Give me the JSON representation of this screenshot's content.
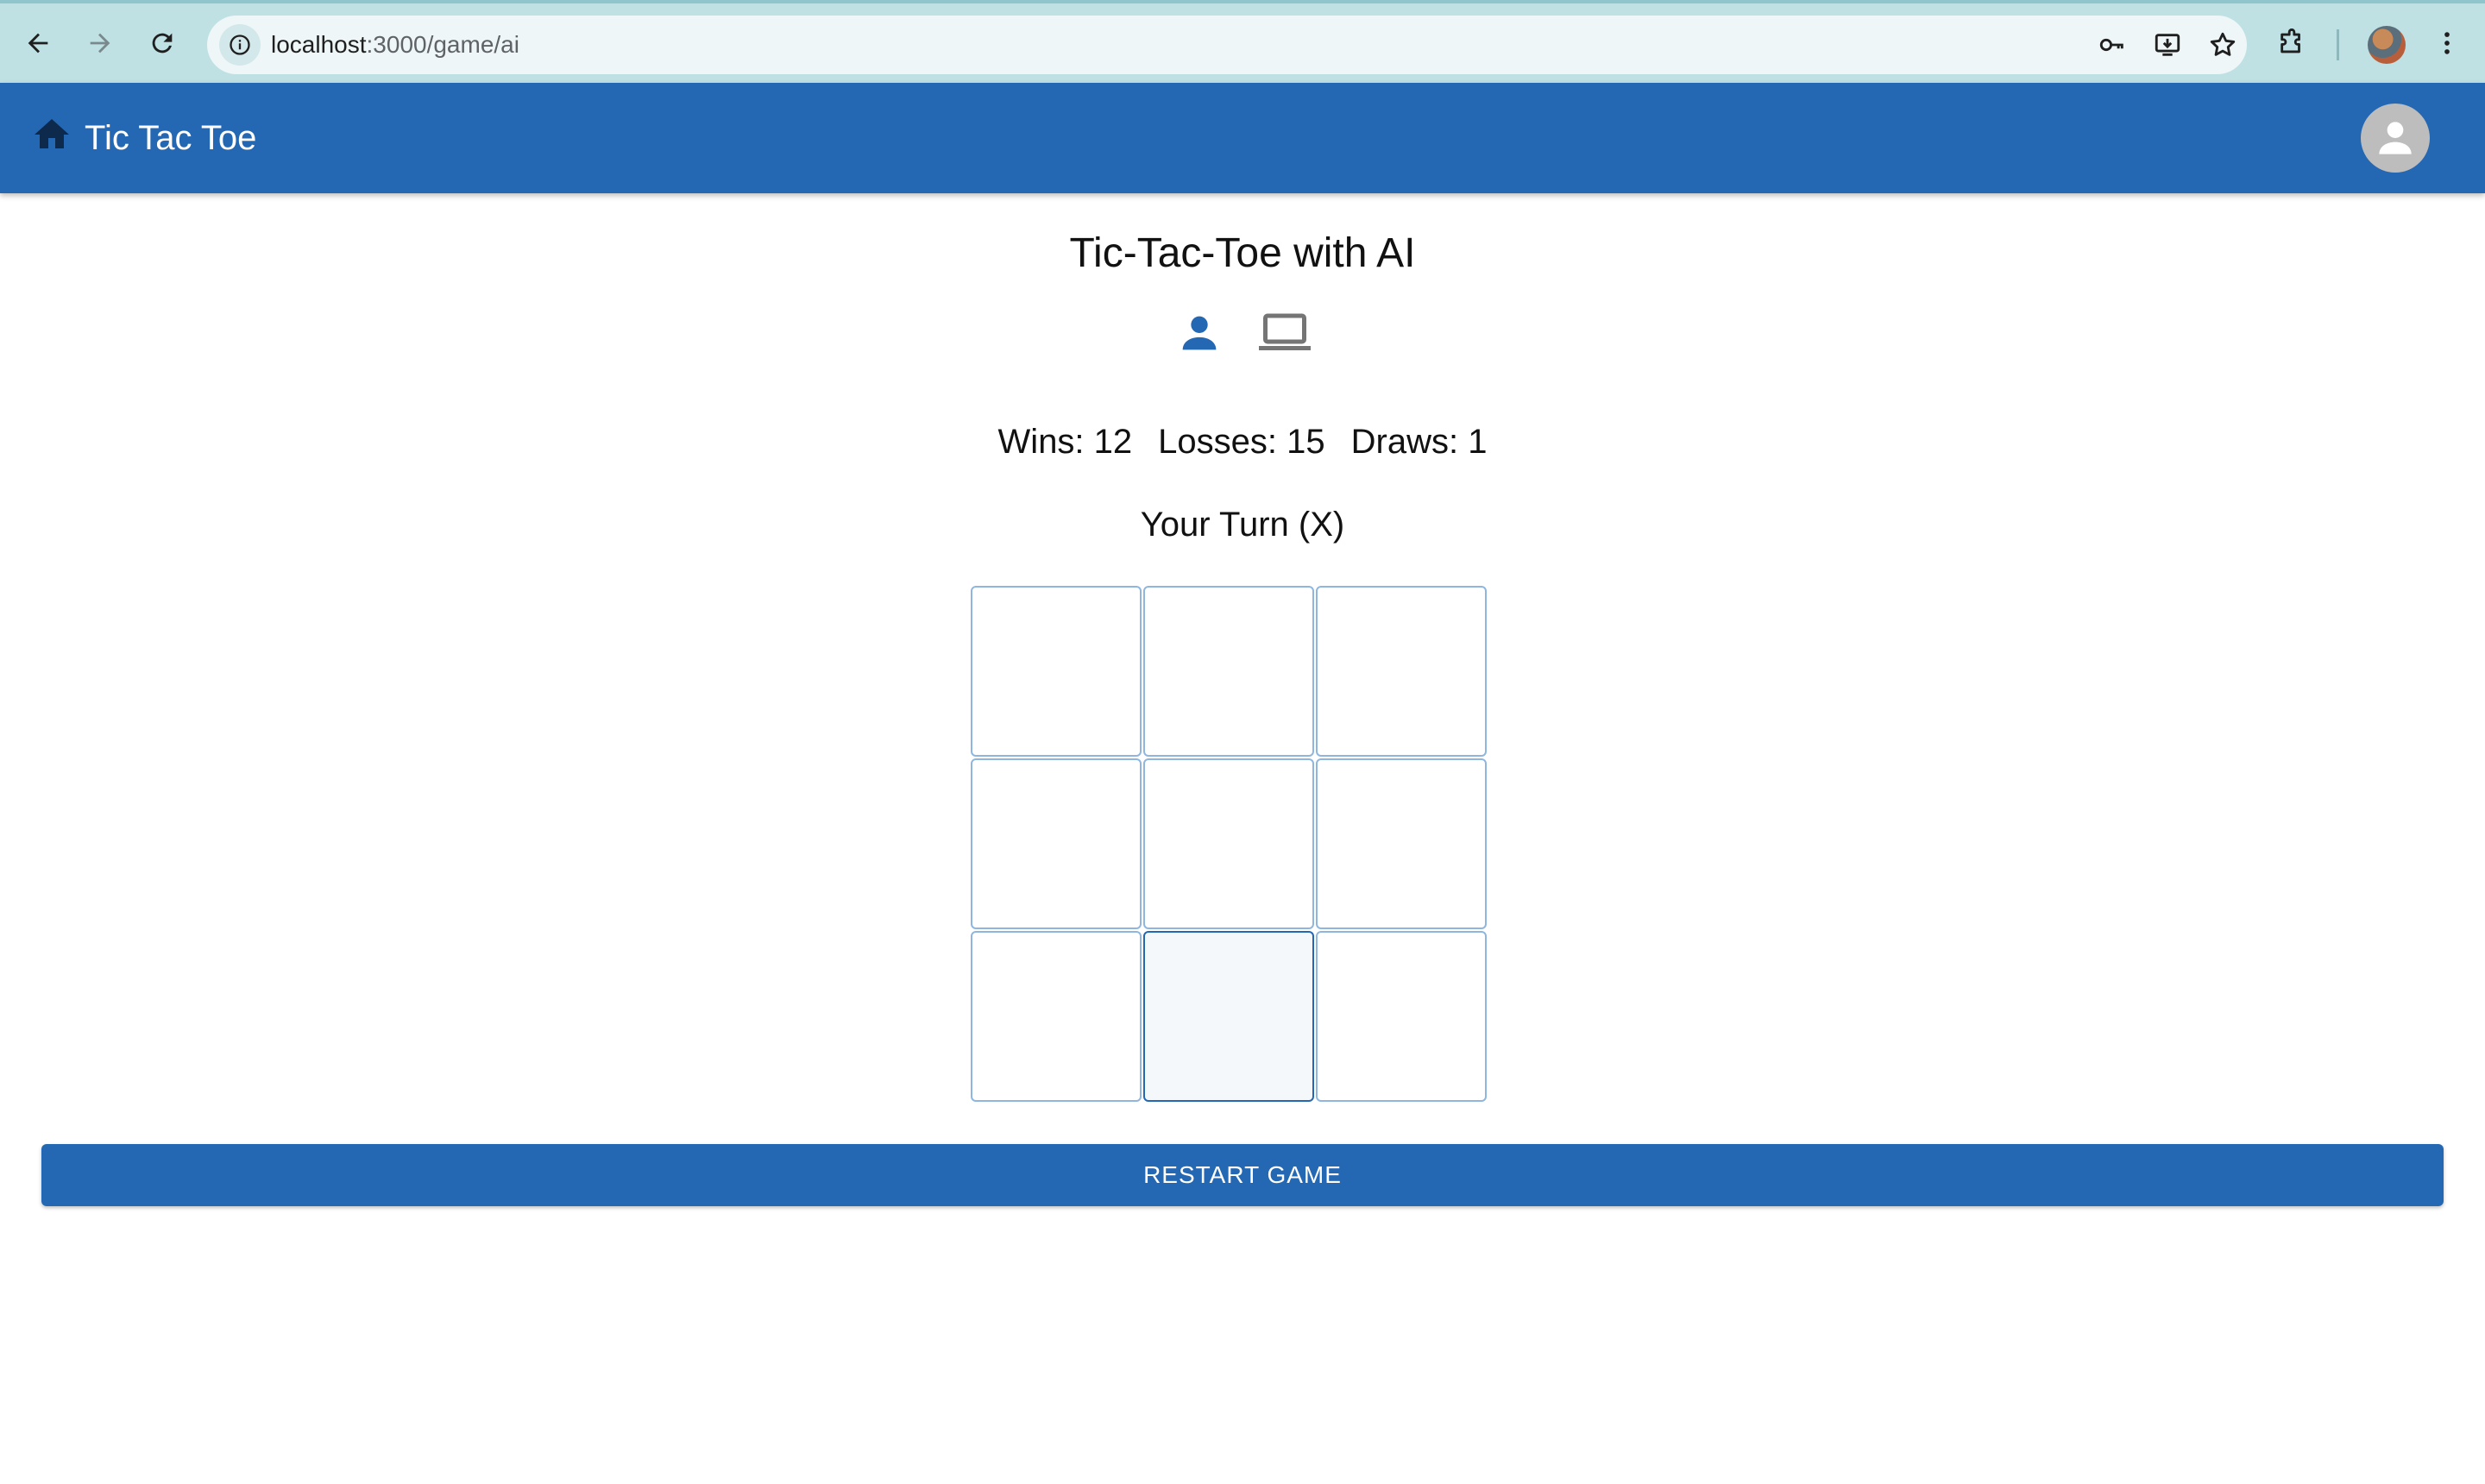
{
  "browser": {
    "url_host": "localhost",
    "url_path": ":3000/game/ai"
  },
  "app_bar": {
    "title": "Tic Tac Toe",
    "color": "#2467b3"
  },
  "game": {
    "title": "Tic-Tac-Toe with AI",
    "modes": [
      {
        "icon": "person-icon",
        "active": true
      },
      {
        "icon": "laptop-icon",
        "active": false
      }
    ],
    "score": {
      "wins": "Wins: 12",
      "losses": "Losses: 15",
      "draws": "Draws: 1"
    },
    "status": "Your Turn (X)",
    "board": [
      "",
      "",
      "",
      "",
      "",
      "",
      "",
      "",
      ""
    ],
    "restart_label": "RESTART GAME"
  }
}
